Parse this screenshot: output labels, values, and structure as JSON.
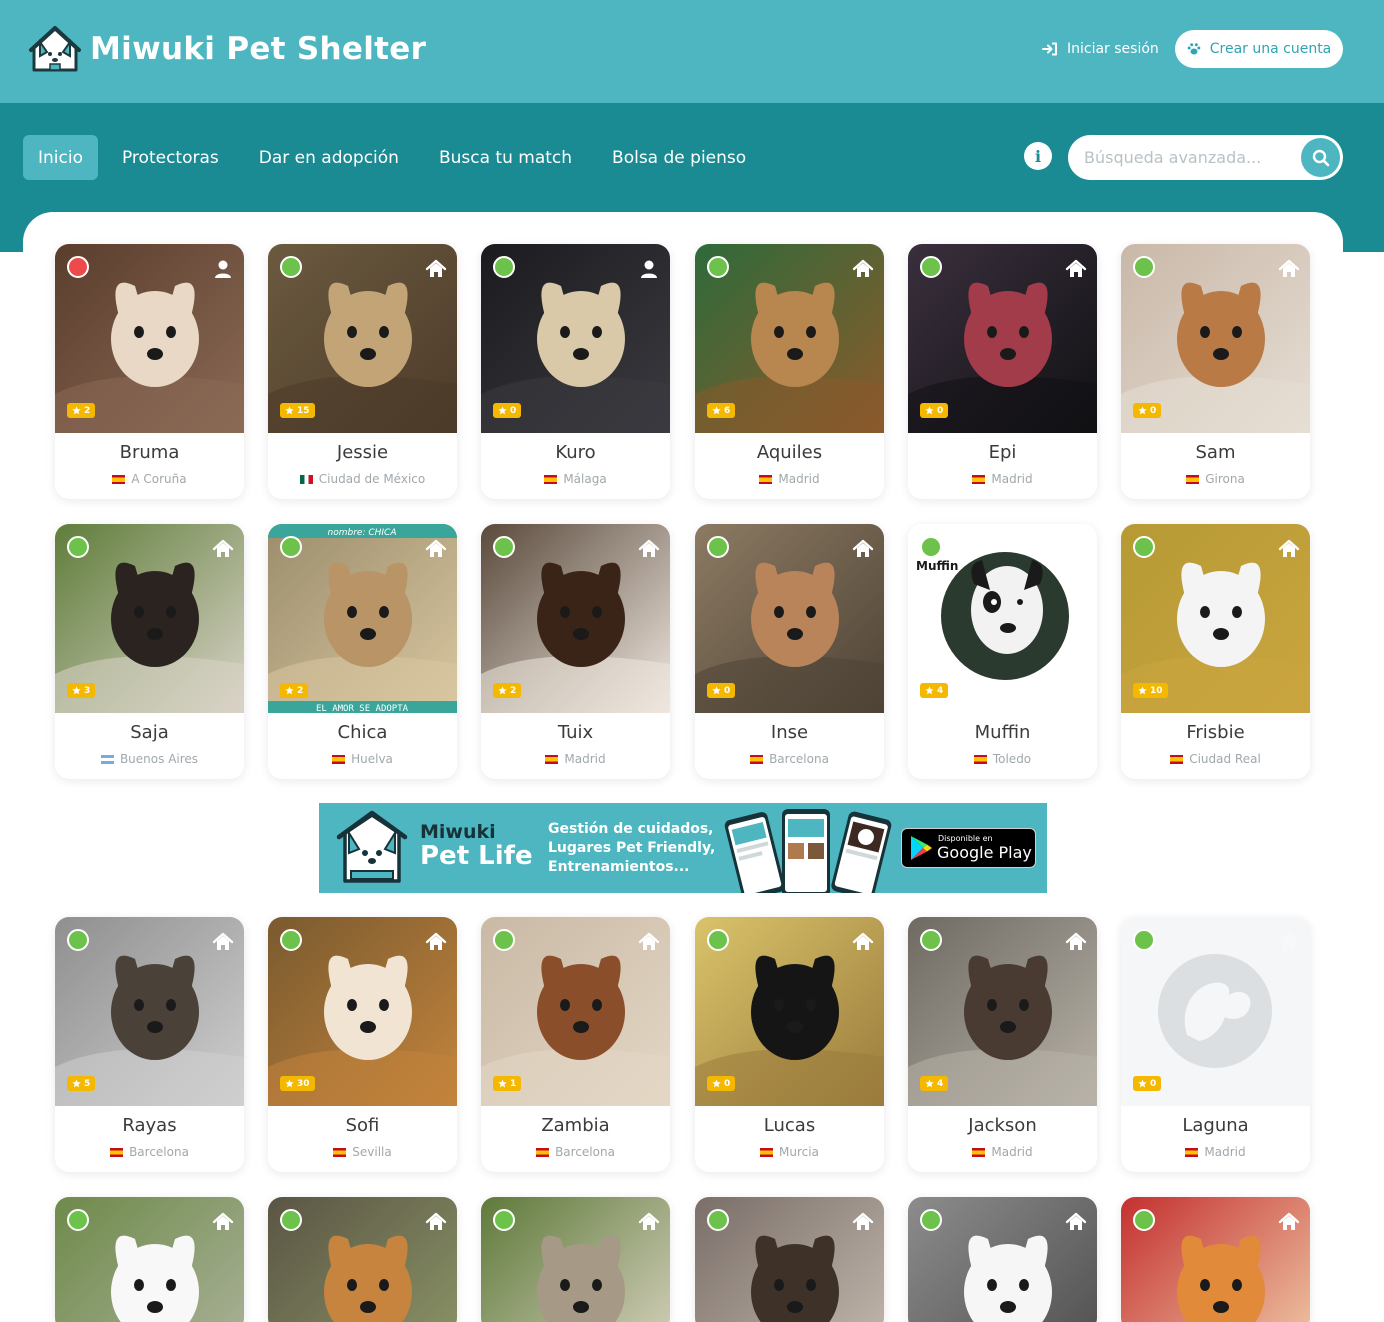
{
  "header": {
    "brand": "Miwuki Pet Shelter",
    "login_label": "Iniciar sesión",
    "signup_label": "Crear una cuenta"
  },
  "nav": {
    "items": [
      {
        "label": "Inicio",
        "active": true
      },
      {
        "label": "Protectoras"
      },
      {
        "label": "Dar en adopción"
      },
      {
        "label": "Busca tu match"
      },
      {
        "label": "Bolsa de pienso"
      }
    ],
    "search_placeholder": "Búsqueda avanzada..."
  },
  "colors": {
    "brand": "#4db6c1",
    "nav": "#1a8a93",
    "status_available": "#6cc24a",
    "status_unavailable": "#ee4a4a",
    "stars": "#f5b800"
  },
  "banner": {
    "brand_line1": "Miwuki",
    "brand_line2": "Pet Life",
    "tagline": [
      "Gestión de cuidados,",
      "Lugares Pet Friendly,",
      "Entrenamientos..."
    ],
    "store_line1": "Disponible en",
    "store_line2": "Google Play"
  },
  "pets": [
    {
      "name": "Bruma",
      "location": "A Coruña",
      "flag": "es",
      "stars": "2",
      "status": "red",
      "icon": "user-icon"
    },
    {
      "name": "Jessie",
      "location": "Ciudad de México",
      "flag": "mx",
      "stars": "15",
      "status": "green",
      "icon": "home-icon"
    },
    {
      "name": "Kuro",
      "location": "Málaga",
      "flag": "es",
      "stars": "0",
      "status": "green",
      "icon": "user-icon"
    },
    {
      "name": "Aquiles",
      "location": "Madrid",
      "flag": "es",
      "stars": "6",
      "status": "green",
      "icon": "home-icon"
    },
    {
      "name": "Epi",
      "location": "Madrid",
      "flag": "es",
      "stars": "0",
      "status": "green",
      "icon": "home-icon"
    },
    {
      "name": "Sam",
      "location": "Girona",
      "flag": "es",
      "stars": "0",
      "status": "green",
      "icon": "home-icon"
    },
    {
      "name": "Saja",
      "location": "Buenos Aires",
      "flag": "ar",
      "stars": "3",
      "status": "green",
      "icon": "home-icon"
    },
    {
      "name": "Chica",
      "location": "Huelva",
      "flag": "es",
      "stars": "2",
      "status": "green",
      "icon": "home-icon",
      "photo_text_top": "nombre: CHICA",
      "photo_text_bottom": "EL AMOR SE ADOPTA"
    },
    {
      "name": "Tuix",
      "location": "Madrid",
      "flag": "es",
      "stars": "2",
      "status": "green",
      "icon": "home-icon"
    },
    {
      "name": "Inse",
      "location": "Barcelona",
      "flag": "es",
      "stars": "0",
      "status": "green",
      "icon": "home-icon"
    },
    {
      "name": "Muffin",
      "location": "Toledo",
      "flag": "es",
      "stars": "4",
      "status": "green",
      "icon": "none",
      "photo_text_top": "Muffin"
    },
    {
      "name": "Frisbie",
      "location": "Ciudad Real",
      "flag": "es",
      "stars": "10",
      "status": "green",
      "icon": "home-icon"
    },
    {
      "name": "Rayas",
      "location": "Barcelona",
      "flag": "es",
      "stars": "5",
      "status": "green",
      "icon": "home-icon"
    },
    {
      "name": "Sofi",
      "location": "Sevilla",
      "flag": "es",
      "stars": "30",
      "status": "green",
      "icon": "home-icon"
    },
    {
      "name": "Zambia",
      "location": "Barcelona",
      "flag": "es",
      "stars": "1",
      "status": "green",
      "icon": "home-icon"
    },
    {
      "name": "Lucas",
      "location": "Murcia",
      "flag": "es",
      "stars": "0",
      "status": "green",
      "icon": "home-icon"
    },
    {
      "name": "Jackson",
      "location": "Madrid",
      "flag": "es",
      "stars": "4",
      "status": "green",
      "icon": "home-icon"
    },
    {
      "name": "Laguna",
      "location": "Madrid",
      "flag": "es",
      "stars": "0",
      "status": "green",
      "icon": "home-icon-faded",
      "placeholder": true
    },
    {
      "status": "green",
      "icon": "home-icon"
    },
    {
      "status": "green",
      "icon": "home-icon"
    },
    {
      "status": "green",
      "icon": "home-icon"
    },
    {
      "status": "green",
      "icon": "home-icon"
    },
    {
      "status": "green",
      "icon": "home-icon"
    },
    {
      "status": "green",
      "icon": "home-icon"
    }
  ]
}
